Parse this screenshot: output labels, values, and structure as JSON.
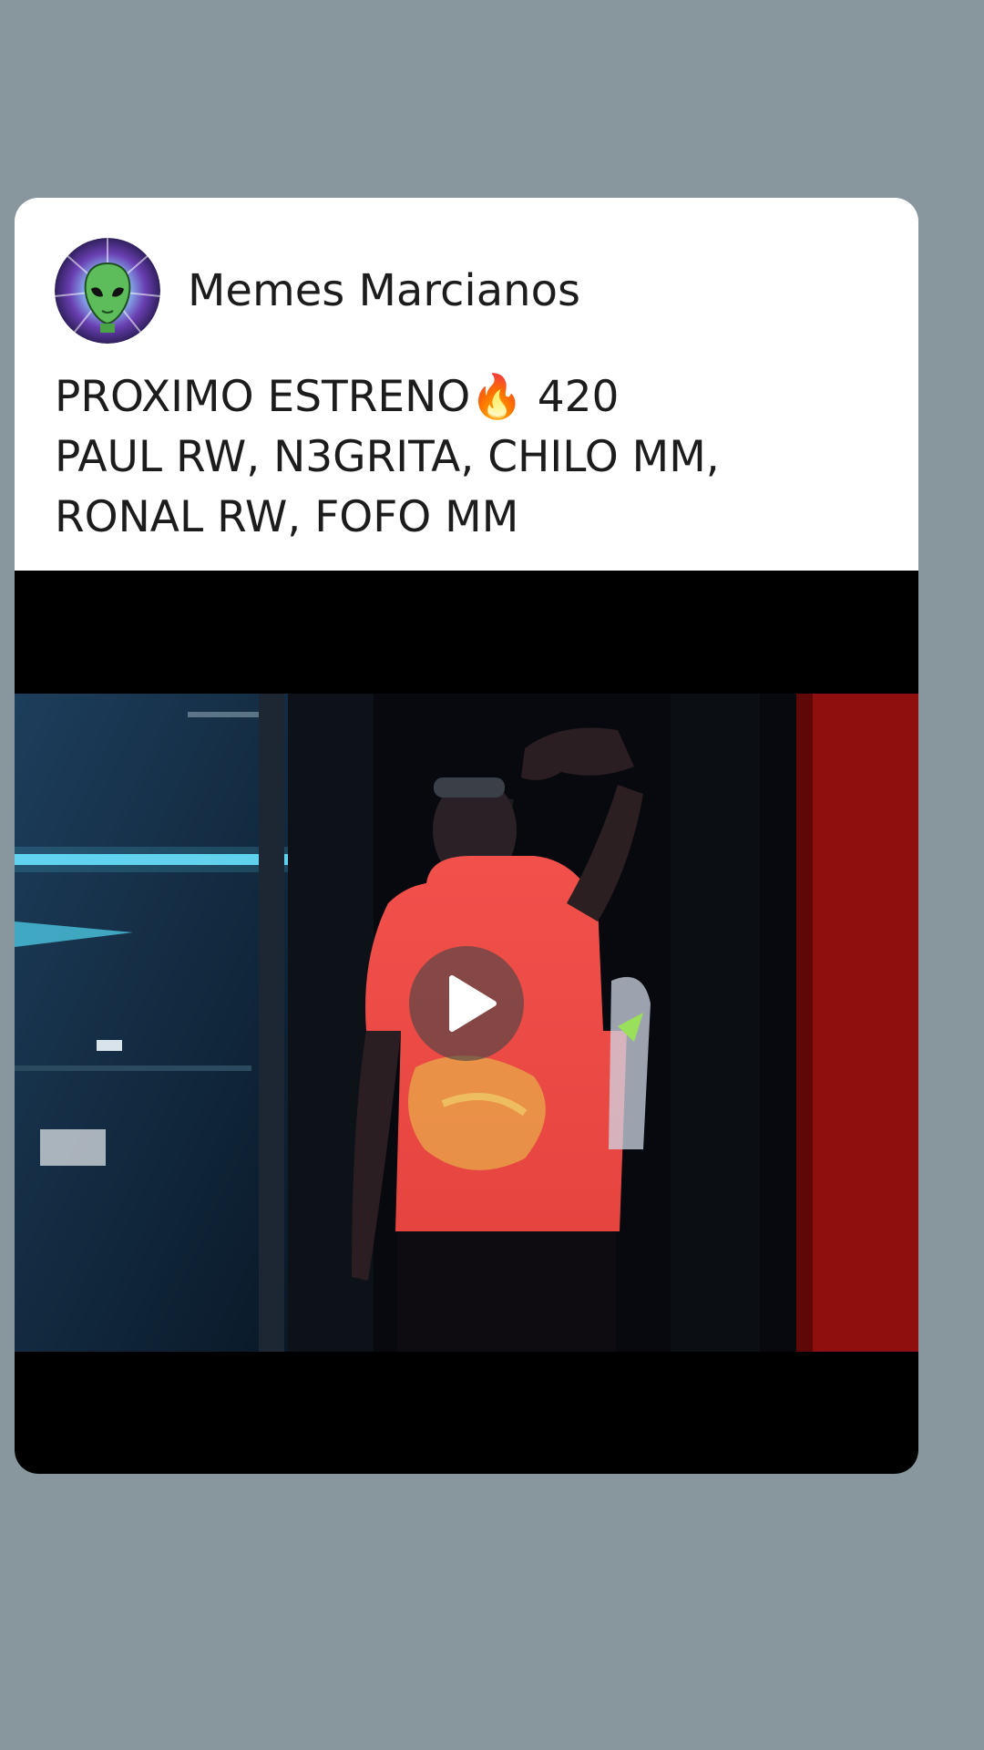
{
  "post": {
    "author": {
      "name": "Memes Marcianos",
      "avatar_icon": "alien-head-icon"
    },
    "caption_lines": [
      "PROXIMO ESTRENO🔥 420",
      "PAUL RW, N3GRITA, CHILO MM,",
      "RONAL RW, FOFO MM"
    ],
    "video": {
      "play_icon": "play-icon"
    }
  },
  "colors": {
    "page_background": "#88969d",
    "card_background": "#ffffff",
    "text": "#1c1c1c",
    "video_background": "#000000",
    "shirt": "#f04a47",
    "neon": "#52d8f4",
    "door_red": "#9a0d0d"
  }
}
